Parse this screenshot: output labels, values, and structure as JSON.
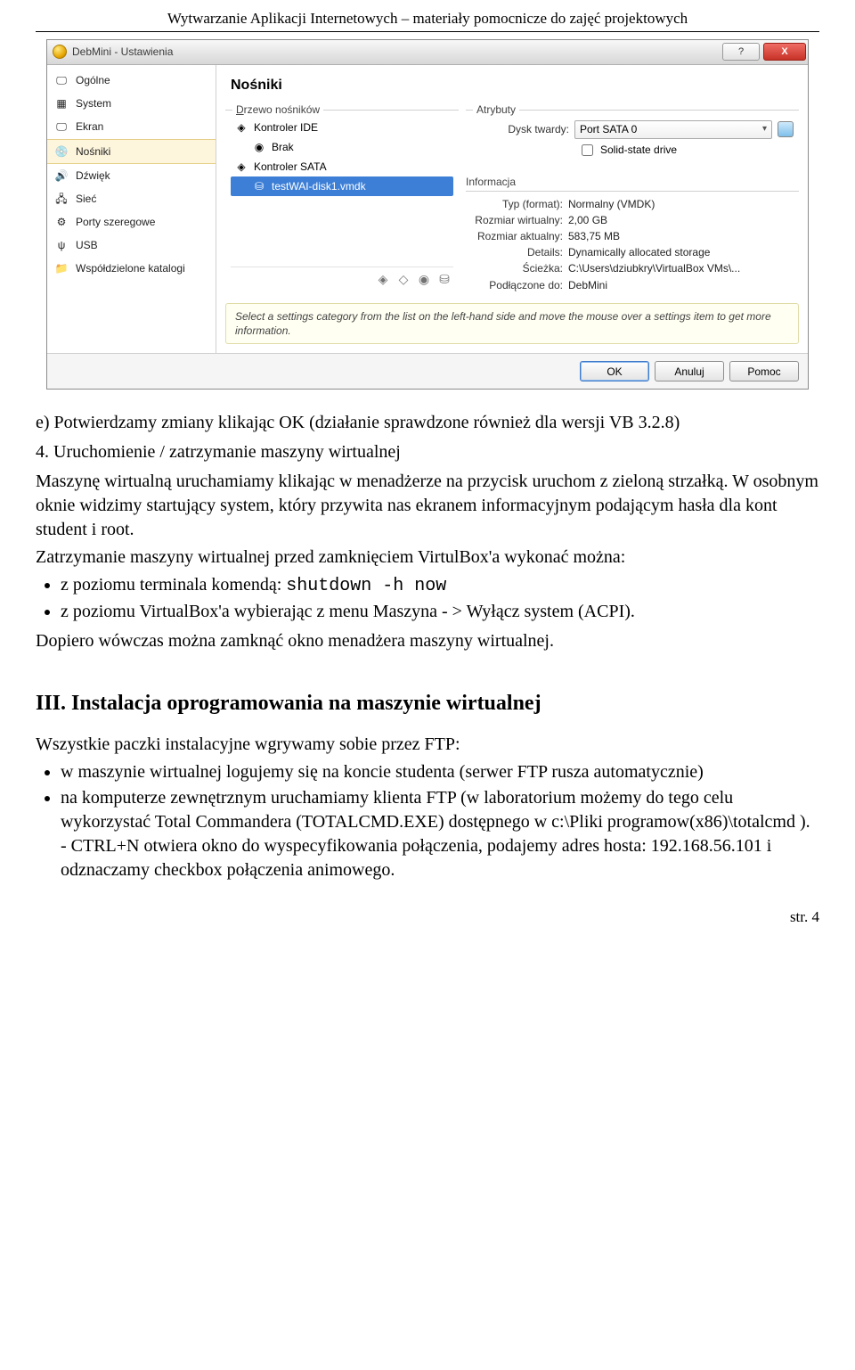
{
  "header": "Wytwarzanie Aplikacji Internetowych – materiały pomocnicze do zajęć projektowych",
  "win": {
    "title": "DebMini - Ustawienia",
    "help_icon": "?",
    "close_icon": "X",
    "sidebar": [
      "Ogólne",
      "System",
      "Ekran",
      "Nośniki",
      "Dźwięk",
      "Sieć",
      "Porty szeregowe",
      "USB",
      "Współdzielone katalogi"
    ],
    "detail_title": "Nośniki",
    "tree_legend": "Drzewo nośników",
    "tree": {
      "ctrl_ide": "Kontroler IDE",
      "brak": "Brak",
      "ctrl_sata": "Kontroler SATA",
      "disk": "testWAI-disk1.vmdk"
    },
    "attr_legend": "Atrybuty",
    "attr": {
      "hdd_label": "Dysk twardy:",
      "hdd_val": "Port SATA 0",
      "ssd": "Solid-state drive"
    },
    "info_head": "Informacja",
    "info": [
      {
        "k": "Typ (format):",
        "v": "Normalny (VMDK)"
      },
      {
        "k": "Rozmiar wirtualny:",
        "v": "2,00 GB"
      },
      {
        "k": "Rozmiar aktualny:",
        "v": "583,75 MB"
      },
      {
        "k": "Details:",
        "v": "Dynamically allocated storage"
      },
      {
        "k": "Ścieżka:",
        "v": "C:\\Users\\dziubkry\\VirtualBox VMs\\..."
      },
      {
        "k": "Podłączone do:",
        "v": "DebMini"
      }
    ],
    "hint": "Select a settings category from the list on the left-hand side and move the mouse over a settings item to get more information.",
    "btn_ok": "OK",
    "btn_cancel": "Anuluj",
    "btn_help": "Pomoc"
  },
  "doc": {
    "p1": "e) Potwierdzamy zmiany klikając OK (działanie sprawdzone również dla wersji VB 3.2.8)",
    "h1": "4. Uruchomienie / zatrzymanie maszyny wirtualnej",
    "p2a": "Maszynę wirtualną uruchamiamy klikając w menadżerze na przycisk uruchom z zieloną strzałką. W osobnym oknie widzimy startujący system, który przywita nas ekranem informacyjnym podającym hasła dla kont student i root.",
    "p2b": "Zatrzymanie maszyny wirtualnej przed zamknięciem VirtulBox'a wykonać można:",
    "b1a": "z poziomu terminala komendą: ",
    "b1b": "shutdown -h now",
    "b2": "z poziomu VirtualBox'a wybierając z menu Maszyna - > Wyłącz system (ACPI).",
    "p3": "Dopiero wówczas można zamknąć okno menadżera maszyny wirtualnej.",
    "h2": "III. Instalacja oprogramowania na maszynie wirtualnej",
    "p4": "Wszystkie paczki instalacyjne wgrywamy sobie przez FTP:",
    "b3": "w maszynie wirtualnej logujemy się na koncie studenta (serwer FTP rusza automatycznie)",
    "b4": "na komputerze zewnętrznym uruchamiamy klienta FTP (w laboratorium możemy do tego celu wykorzystać Total Commandera (TOTALCMD.EXE) dostępnego w c:\\Pliki programow(x86)\\totalcmd ).",
    "b4a": "- CTRL+N otwiera okno do wyspecyfikowania połączenia, podajemy adres hosta: 192.168.56.101 i odznaczamy checkbox połączenia animowego.",
    "pagenum": "str. 4"
  }
}
